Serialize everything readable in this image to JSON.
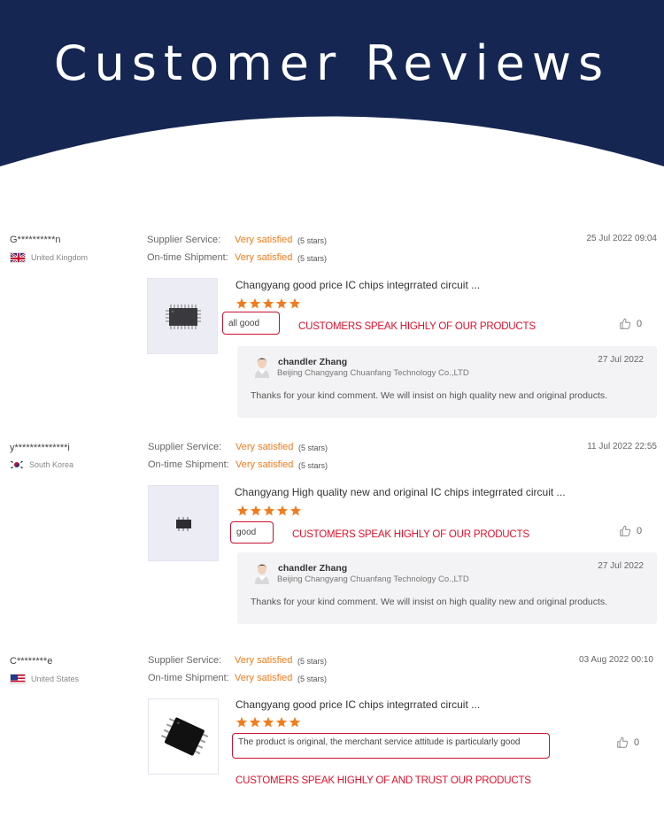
{
  "banner": {
    "title": "Customer Reviews",
    "color": "#162652"
  },
  "accent": "#f07c1d",
  "highlight_color": "#e0102a",
  "reviews": [
    {
      "user": "G**********n",
      "country": "United Kingdom",
      "flag": "uk-flag-icon",
      "supplier_label": "Supplier Service:",
      "supplier_value": "Very satisfied",
      "supplier_stars": "(5 stars)",
      "shipment_label": "On-time Shipment:",
      "shipment_value": "Very satisfied",
      "shipment_stars": "(5 stars)",
      "date": "25 Jul 2022 09:04",
      "product": "Changyang good price IC chips integrrated circuit ...",
      "rating": 5,
      "comment": "all good",
      "highlight": "CUSTOMERS SPEAK HIGHLY OF OUR PRODUCTS",
      "likes": "0",
      "reply": {
        "name": "chandler Zhang",
        "company": "Beijing Changyang Chuanfang Technology Co.,LTD",
        "date": "27 Jul 2022",
        "text": "Thanks for your kind comment. We will insist on high quality new and  original products."
      }
    },
    {
      "user": "y**************i",
      "country": "South Korea",
      "flag": "korea-flag-icon",
      "supplier_label": "Supplier Service:",
      "supplier_value": "Very satisfied",
      "supplier_stars": "(5 stars)",
      "shipment_label": "On-time Shipment:",
      "shipment_value": "Very satisfied",
      "shipment_stars": "(5 stars)",
      "date": "11 Jul 2022 22:55",
      "product": "Changyang High quality new and original IC chips integrrated circuit ...",
      "rating": 5,
      "comment": "good",
      "highlight": "CUSTOMERS SPEAK HIGHLY OF OUR PRODUCTS",
      "likes": "0",
      "reply": {
        "name": "chandler Zhang",
        "company": "Beijing Changyang Chuanfang Technology Co.,LTD",
        "date": "27 Jul 2022",
        "text": "Thanks for your kind comment. We will insist on high quality new and  original products."
      }
    },
    {
      "user": "C********e",
      "country": "United States",
      "flag": "us-flag-icon",
      "supplier_label": "Supplier Service:",
      "supplier_value": "Very satisfied",
      "supplier_stars": "(5 stars)",
      "shipment_label": "On-time Shipment:",
      "shipment_value": "Very satisfied",
      "shipment_stars": "(5 stars)",
      "date": "03 Aug 2022 00:10",
      "product": "Changyang good price IC chips integrrated circuit ...",
      "rating": 5,
      "comment": "The product is original, the merchant service attitude is particularly good",
      "highlight": "CUSTOMERS SPEAK HIGHLY OF AND TRUST OUR PRODUCTS",
      "likes": "0"
    }
  ]
}
